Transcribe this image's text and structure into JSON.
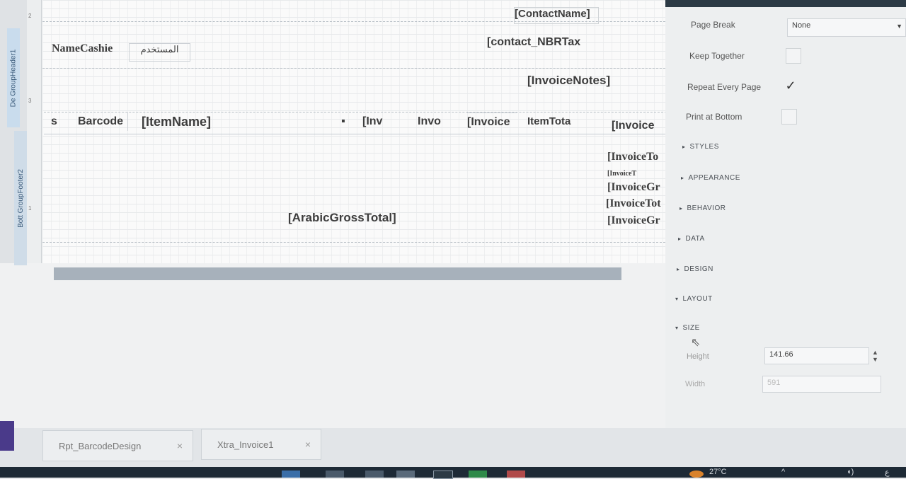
{
  "report": {
    "ruler_numbers": [
      "2",
      "3",
      "1"
    ],
    "bands": {
      "group_header": "De GroupHeader1",
      "group_footer": "Bott GroupFooter2"
    },
    "fields": {
      "contact_name": "[ContactName]",
      "contact_nbr_tax": "[contact_NBRTax",
      "name_cashier": "NameCashie",
      "cashier_ar": "المستخدم",
      "invoice_notes": "[InvoiceNotes]",
      "arabic_gross_total": "[ArabicGrossTotal]"
    },
    "detail_cells": {
      "s": "s",
      "barcode": "Barcode",
      "item_name": "[ItemName]",
      "inv1": "[Inv",
      "inv2": "Invo",
      "inv3": "[Invoice",
      "item_total": "ItemTota",
      "inv4": "[Invoice"
    },
    "totals": [
      "[InvoiceTo",
      "[InvoiceT",
      "[InvoiceGr",
      "[InvoiceTot",
      "[InvoiceGr"
    ]
  },
  "properties": {
    "page_break_label": "Page Break",
    "page_break_value": "None",
    "keep_together_label": "Keep Together",
    "repeat_every_page_label": "Repeat Every Page",
    "repeat_every_page_checked": "✓",
    "print_at_bottom_label": "Print at Bottom",
    "sections": [
      "STYLES",
      "APPEARANCE",
      "BEHAVIOR",
      "DATA",
      "DESIGN",
      "LAYOUT",
      "SIZE"
    ],
    "height_label": "Height",
    "height_value": "141.66",
    "width_label": "Width",
    "width_value": "591"
  },
  "tabs": [
    {
      "label": "Rpt_BarcodeDesign",
      "close": "×"
    },
    {
      "label": "Xtra_Invoice1",
      "close": "×"
    }
  ],
  "taskbar": {
    "temperature": "27°C",
    "language": "ع"
  },
  "icons": [
    "collapse-triangle-icon",
    "expand-triangle-icon",
    "checkmark-icon",
    "spinner-icon",
    "close-icon",
    "mouse-cursor-icon"
  ]
}
